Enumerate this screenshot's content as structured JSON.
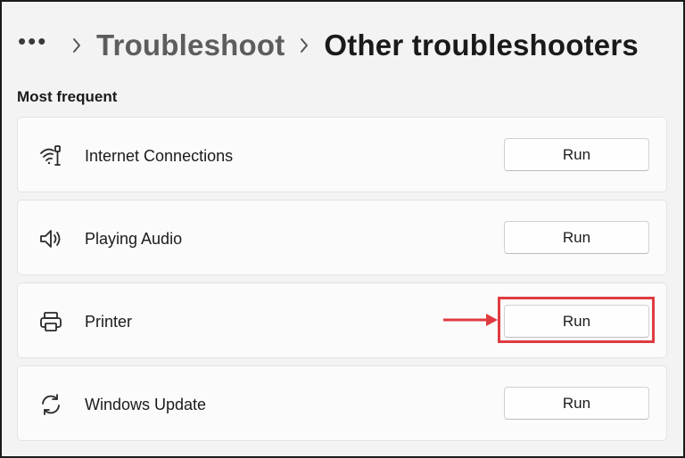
{
  "breadcrumb": {
    "more_label": "•••",
    "parent": "Troubleshoot",
    "current": "Other troubleshooters"
  },
  "section": {
    "title": "Most frequent"
  },
  "troubleshooters": [
    {
      "label": "Internet Connections",
      "icon": "wifi-network-icon",
      "button": "Run"
    },
    {
      "label": "Playing Audio",
      "icon": "speaker-icon",
      "button": "Run"
    },
    {
      "label": "Printer",
      "icon": "printer-icon",
      "button": "Run",
      "highlighted": true
    },
    {
      "label": "Windows Update",
      "icon": "sync-icon",
      "button": "Run"
    }
  ],
  "colors": {
    "highlight": "#e03b40",
    "background": "#f3f3f3",
    "card": "#fbfbfb"
  }
}
